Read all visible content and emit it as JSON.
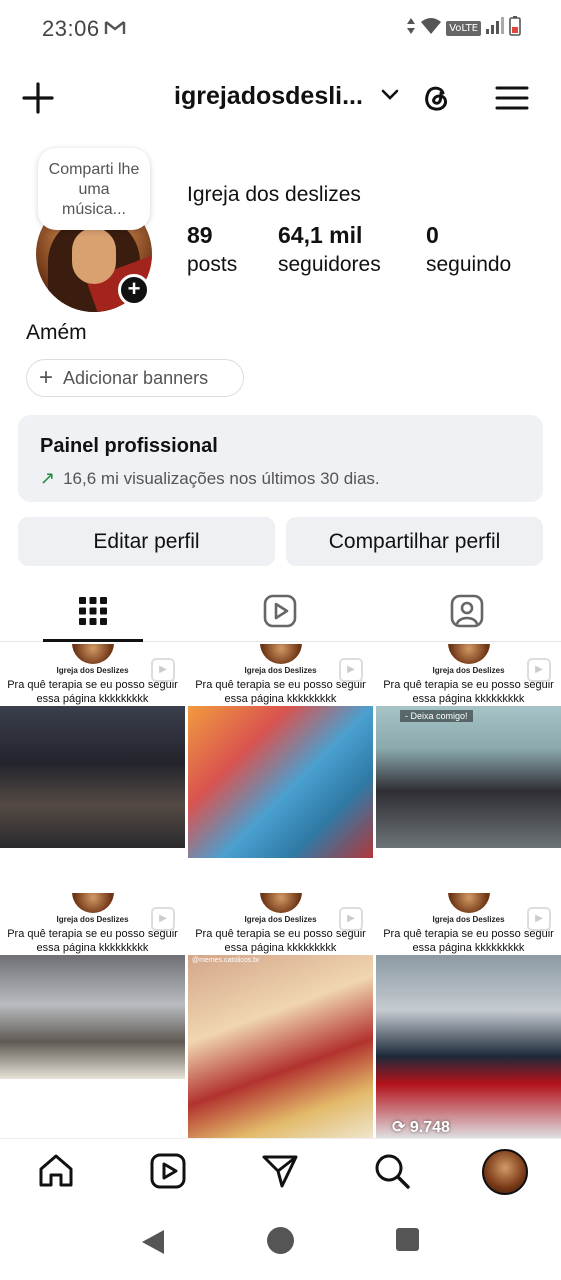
{
  "status_bar": {
    "time": "23:06",
    "network_label": "VoLTE"
  },
  "header": {
    "username": "igrejadosdesli..."
  },
  "profile": {
    "note_text": "Comparti lhe uma música...",
    "display_name": "Igreja dos deslizes",
    "stats": [
      {
        "value": "89",
        "label": "posts"
      },
      {
        "value": "64,1 mil",
        "label": "seguidores"
      },
      {
        "value": "0",
        "label": "seguindo"
      }
    ],
    "bio": "Amém",
    "banners_label": "Adicionar banners"
  },
  "professional_panel": {
    "title": "Painel profissional",
    "subtitle": "16,6 mi visualizações nos últimos 30 dias."
  },
  "actions": {
    "edit_label": "Editar perfil",
    "share_label": "Compartilhar perfil"
  },
  "grid": {
    "posts": [
      {
        "channel": "Igreja dos Deslizes",
        "caption": "Pra quê terapia se eu posso seguir essa página kkkkkkkkk",
        "overlay": "",
        "views": ""
      },
      {
        "channel": "Igreja dos Deslizes",
        "caption": "Pra quê terapia se eu posso seguir essa página kkkkkkkkk",
        "overlay": "",
        "views": ""
      },
      {
        "channel": "Igreja dos Deslizes",
        "caption": "Pra quê terapia se eu posso seguir essa página kkkkkkkkk",
        "overlay": "- Deixa comigo!",
        "views": ""
      },
      {
        "channel": "Igreja dos Deslizes",
        "caption": "Pra quê terapia se eu posso seguir essa página kkkkkkkkk",
        "overlay": "",
        "views": ""
      },
      {
        "channel": "Igreja dos Deslizes",
        "caption": "Pra quê terapia se eu posso seguir essa página kkkkkkkkk",
        "overlay": "@memes.catolicos.br",
        "views": ""
      },
      {
        "channel": "Igreja dos Deslizes",
        "caption": "Pra quê terapia se eu posso seguir essa página kkkkkkkkk",
        "overlay": "",
        "views": "9.748"
      }
    ]
  },
  "colors": {
    "trend_green": "#1f8a3e",
    "panel_bg": "#f0f1f4",
    "button_bg": "#eef0f3"
  }
}
